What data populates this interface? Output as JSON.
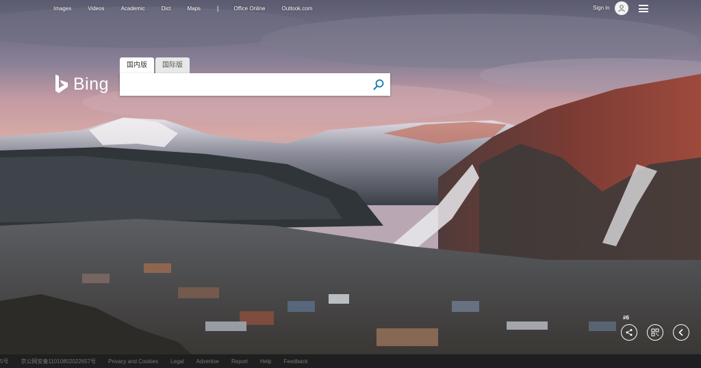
{
  "nav": {
    "links": [
      "Images",
      "Videos",
      "Academic",
      "Dict",
      "Maps"
    ],
    "separator": "|",
    "links2": [
      "Office Online",
      "Outlook.com"
    ],
    "signin": "Sign in"
  },
  "logo": {
    "text": "Bing"
  },
  "search": {
    "tabs": [
      "国内版",
      "国际版"
    ],
    "active_tab": "国内版",
    "value": "",
    "placeholder": ""
  },
  "image_controls": {
    "count": "#6",
    "icons": [
      "share-icon",
      "qr-code-icon",
      "previous-icon"
    ]
  },
  "footer": {
    "items": [
      "5号",
      "京公网安备11010802022657号",
      "Privacy and Cookies",
      "Legal",
      "Advertise",
      "Report",
      "Help",
      "Feedback"
    ]
  },
  "colors": {
    "accent": "#0c7ab0",
    "footer_bg": "#1f1f21"
  }
}
